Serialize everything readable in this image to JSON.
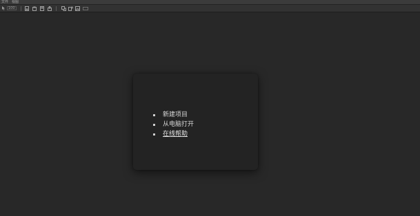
{
  "menubar": {
    "items": [
      "文件",
      "视图"
    ]
  },
  "toolbar": {
    "buttons": [
      {
        "name": "select-icon"
      },
      {
        "name": "zoom-level",
        "label": "100"
      },
      {
        "name": "new-icon"
      },
      {
        "name": "open-icon"
      },
      {
        "name": "save-icon"
      },
      {
        "name": "export-icon"
      },
      {
        "name": "crop-icon"
      },
      {
        "name": "rotate-icon"
      },
      {
        "name": "image-icon"
      },
      {
        "name": "more-icon"
      }
    ]
  },
  "start_menu": {
    "items": [
      {
        "label": "新建项目"
      },
      {
        "label": "从电脑打开"
      },
      {
        "label": "在线帮助"
      }
    ]
  },
  "colors": {
    "background": "#282828",
    "dialog": "#232323",
    "menubar": "#3b3b3b",
    "toolbar": "#323232",
    "text": "#d9d9d9"
  }
}
